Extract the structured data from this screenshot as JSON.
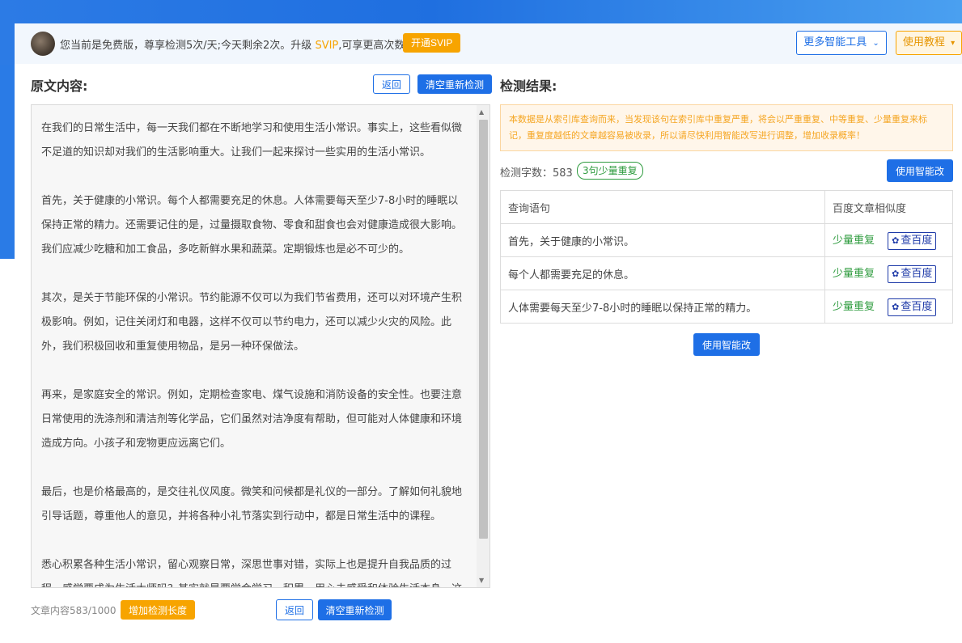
{
  "topbar": {
    "notice_prefix": "您当前是免费版，尊享检测5次/天;今天剩余2次。升级",
    "svip_text": "SVIP",
    "notice_suffix": ",可享更高次数",
    "open_svip_label": "开通SVIP",
    "more_tools_label": "更多智能工具",
    "tutorial_label": "使用教程"
  },
  "left": {
    "title": "原文内容:",
    "back_label": "返回",
    "clear_label": "清空重新检测",
    "paragraphs": [
      "在我们的日常生活中，每一天我们都在不断地学习和使用生活小常识。事实上，这些看似微不足道的知识却对我们的生活影响重大。让我们一起来探讨一些实用的生活小常识。",
      "首先，关于健康的小常识。每个人都需要充足的休息。人体需要每天至少7-8小时的睡眠以保持正常的精力。还需要记住的是，过量摄取食物、零食和甜食也会对健康造成很大影响。我们应减少吃糖和加工食品，多吃新鲜水果和蔬菜。定期锻炼也是必不可少的。",
      "其次，是关于节能环保的小常识。节约能源不仅可以为我们节省费用，还可以对环境产生积极影响。例如，记住关闭灯和电器，这样不仅可以节约电力，还可以减少火灾的风险。此外，我们积极回收和重复使用物品，是另一种环保做法。",
      "再来，是家庭安全的常识。例如，定期检查家电、煤气设施和消防设备的安全性。也要注意日常使用的洗涤剂和清洁剂等化学品，它们虽然对洁净度有帮助，但可能对人体健康和环境造成方向。小孩子和宠物更应远离它们。",
      "最后，也是价格最高的，是交往礼仪风度。微笑和问候都是礼仪的一部分。了解如何礼貌地引导话题，尊重他人的意见，并将各种小礼节落实到行动中，都是日常生活中的课程。",
      "悉心积累各种生活小常识，留心观察日常，深思世事对错，实际上也是提升自我品质的过程。感觉要成为生活大师吗？其实就是要学会学习、积累、用心去感受和体验生活本身。这"
    ],
    "count_text": "文章内容583/1000",
    "increase_label": "增加检测长度",
    "bottom_back_label": "返回",
    "bottom_clear_label": "清空重新检测"
  },
  "right": {
    "title": "检测结果:",
    "warning": "本数据是从索引库查询而来，当发现该句在索引库中重复严重，将会以严重重复、中等重复、少量重复来标记，重复度越低的文章越容易被收录，所以请尽快利用智能改写进行调整，增加收录概率！",
    "detect_count_label": "检测字数：583",
    "badge": "3句少量重复",
    "rewrite_label": "使用智能改写",
    "table_headers": [
      "查询语句",
      "百度文章相似度"
    ],
    "rows": [
      {
        "sentence": "首先，关于健康的小常识。",
        "level": "少量重复",
        "action": "查百度"
      },
      {
        "sentence": "每个人都需要充足的休息。",
        "level": "少量重复",
        "action": "查百度"
      },
      {
        "sentence": "人体需要每天至少7-8小时的睡眠以保持正常的精力。",
        "level": "少量重复",
        "action": "查百度"
      }
    ],
    "bottom_rewrite_label": "使用智能改写"
  }
}
